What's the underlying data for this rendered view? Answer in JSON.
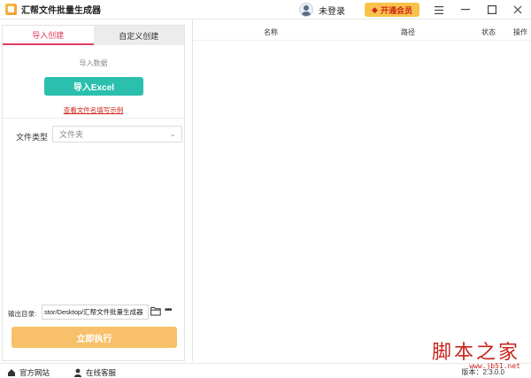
{
  "app": {
    "title": "汇帮文件批量生成器",
    "login_text": "未登录",
    "vip_label": "开通会员"
  },
  "window_controls": {
    "menu_icon": "hamburger-menu-icon",
    "minimize_icon": "minimize-icon",
    "maximize_icon": "maximize-icon",
    "close_icon": "close-icon"
  },
  "left_panel": {
    "tabs": [
      {
        "label": "导入创建",
        "active": true
      },
      {
        "label": "自定义创建",
        "active": false
      }
    ],
    "import_label": "导入数据",
    "import_button": "导入Excel",
    "example_link": "查看文件名填写示例",
    "file_type_label": "文件类型",
    "file_type_value": "文件夹",
    "output_label": "输出目录:",
    "output_value": "stor/Desktop/汇帮文件批量生成器",
    "run_button": "立即执行"
  },
  "table": {
    "columns": [
      "名称",
      "路径",
      "状态",
      "操作"
    ],
    "rows": []
  },
  "footer": {
    "website_label": "官方网站",
    "service_label": "在线客服",
    "version_text": "版本：2.3.0.0"
  },
  "watermark": {
    "text": "脚本之家",
    "url": "www.jb51.net"
  },
  "colors": {
    "accent_pink": "#e0405e",
    "teal_button": "#2bbfae",
    "run_button": "#f8c06a",
    "vip_button": "#f8c24a",
    "link_red": "#d0241b"
  }
}
